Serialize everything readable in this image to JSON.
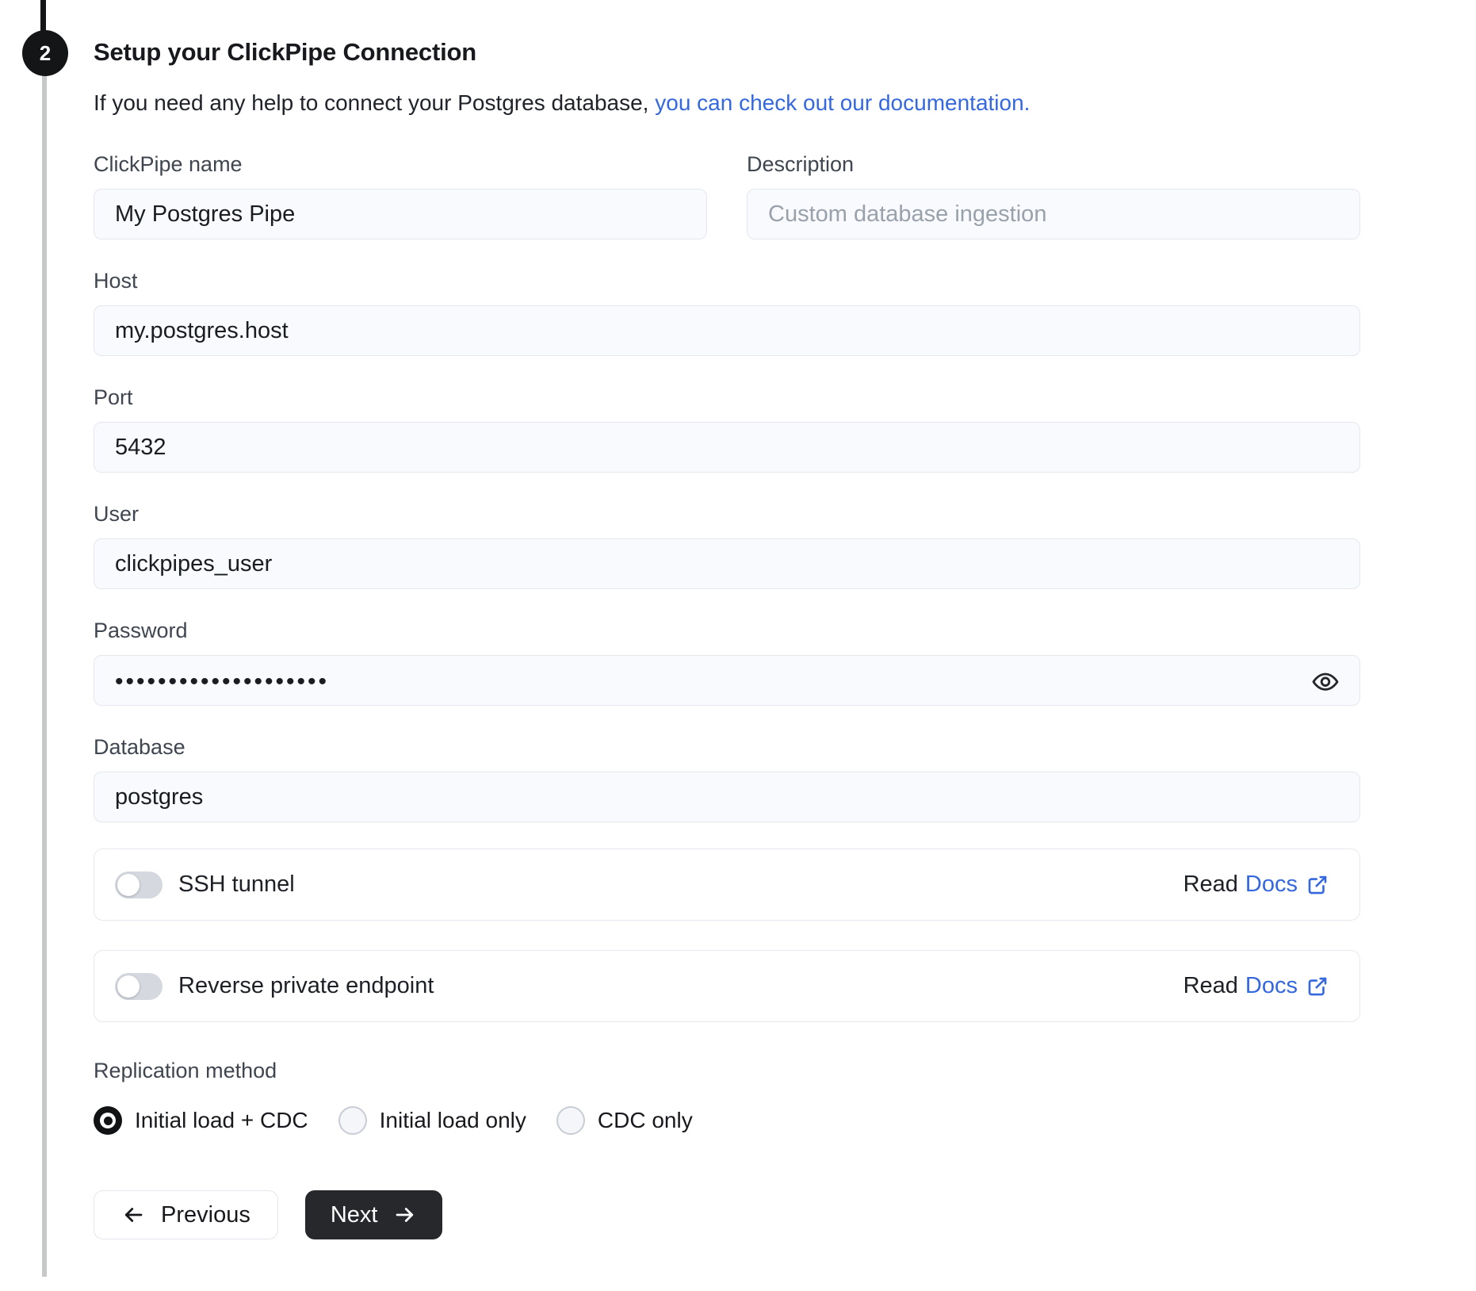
{
  "step": {
    "number": "2"
  },
  "header": {
    "title": "Setup your ClickPipe Connection",
    "subtitle_text": "If you need any help to connect your Postgres database, ",
    "subtitle_link": "you can check out our documentation."
  },
  "form": {
    "clickpipe_name": {
      "label": "ClickPipe name",
      "value": "My Postgres Pipe"
    },
    "description": {
      "label": "Description",
      "value": "",
      "placeholder": "Custom database ingestion"
    },
    "host": {
      "label": "Host",
      "value": "my.postgres.host"
    },
    "port": {
      "label": "Port",
      "value": "5432"
    },
    "user": {
      "label": "User",
      "value": "clickpipes_user"
    },
    "password": {
      "label": "Password",
      "value": "••••••••••••••••••••"
    },
    "database": {
      "label": "Database",
      "value": "postgres"
    }
  },
  "toggles": [
    {
      "label": "SSH tunnel",
      "state": "off",
      "read_label": "Read",
      "docs_label": "Docs",
      "docs_icon": "external-link-icon"
    },
    {
      "label": "Reverse private endpoint",
      "state": "off",
      "read_label": "Read",
      "docs_label": "Docs",
      "docs_icon": "external-link-icon"
    }
  ],
  "replication": {
    "label": "Replication method",
    "options": [
      {
        "label": "Initial load + CDC",
        "selected": true
      },
      {
        "label": "Initial load only",
        "selected": false
      },
      {
        "label": "CDC only",
        "selected": false
      }
    ]
  },
  "actions": {
    "previous_label": "Previous",
    "next_label": "Next"
  },
  "icons": {
    "password_visibility": "eye-icon",
    "previous": "arrow-left-icon",
    "next": "arrow-right-icon"
  },
  "colors": {
    "accent_blue": "#3568de",
    "dark_button": "#26282b",
    "step_circle": "#141517",
    "input_background": "#f8fafd",
    "input_border": "#e4e8ed",
    "toggle_track": "#d5d9df"
  }
}
